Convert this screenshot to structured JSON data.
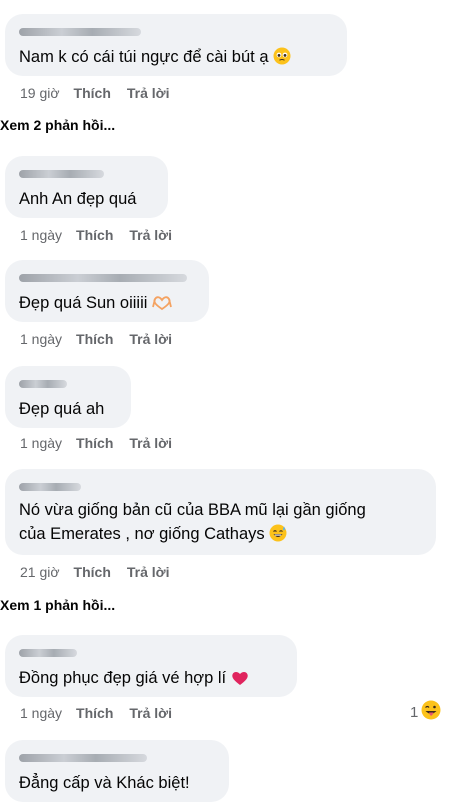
{
  "comments": [
    {
      "text": "Nam k có cái túi ngực để cài bút ạ",
      "time": "19 giờ",
      "like": "Thích",
      "reply": "Trả lời"
    },
    {
      "text": "Anh An đẹp quá",
      "time": "1 ngày",
      "like": "Thích",
      "reply": "Trả lời"
    },
    {
      "text": "Đẹp quá Sun oiiiii",
      "time": "1 ngày",
      "like": "Thích",
      "reply": "Trả lời"
    },
    {
      "text": "Đẹp quá ah",
      "time": "1 ngày",
      "like": "Thích",
      "reply": "Trả lời"
    },
    {
      "text_line1": "Nó vừa giống bản cũ của BBA mũ lại gần giống",
      "text_line2": "của Emerates , nơ giống Cathays",
      "time": "21 giờ",
      "like": "Thích",
      "reply": "Trả lời"
    },
    {
      "text": "Đồng phục đẹp giá vé hợp lí",
      "time": "1 ngày",
      "like": "Thích",
      "reply": "Trả lời",
      "reaction_count": "1"
    },
    {
      "text": "Đẳng cấp và Khác biệt!"
    }
  ],
  "view_replies": [
    "Xem 2 phản hồi...",
    "Xem 1 phản hồi..."
  ],
  "icons": {
    "pleading": "pleading-face-icon",
    "heart_hands": "heart-hands-icon",
    "sweat_smile": "sweat-smile-icon",
    "heart": "red-heart-icon",
    "tongue": "tongue-face-icon"
  },
  "colors": {
    "bubble": "#f0f2f5",
    "meta": "#65676b",
    "text": "#050505",
    "heart": "#e0245e"
  }
}
